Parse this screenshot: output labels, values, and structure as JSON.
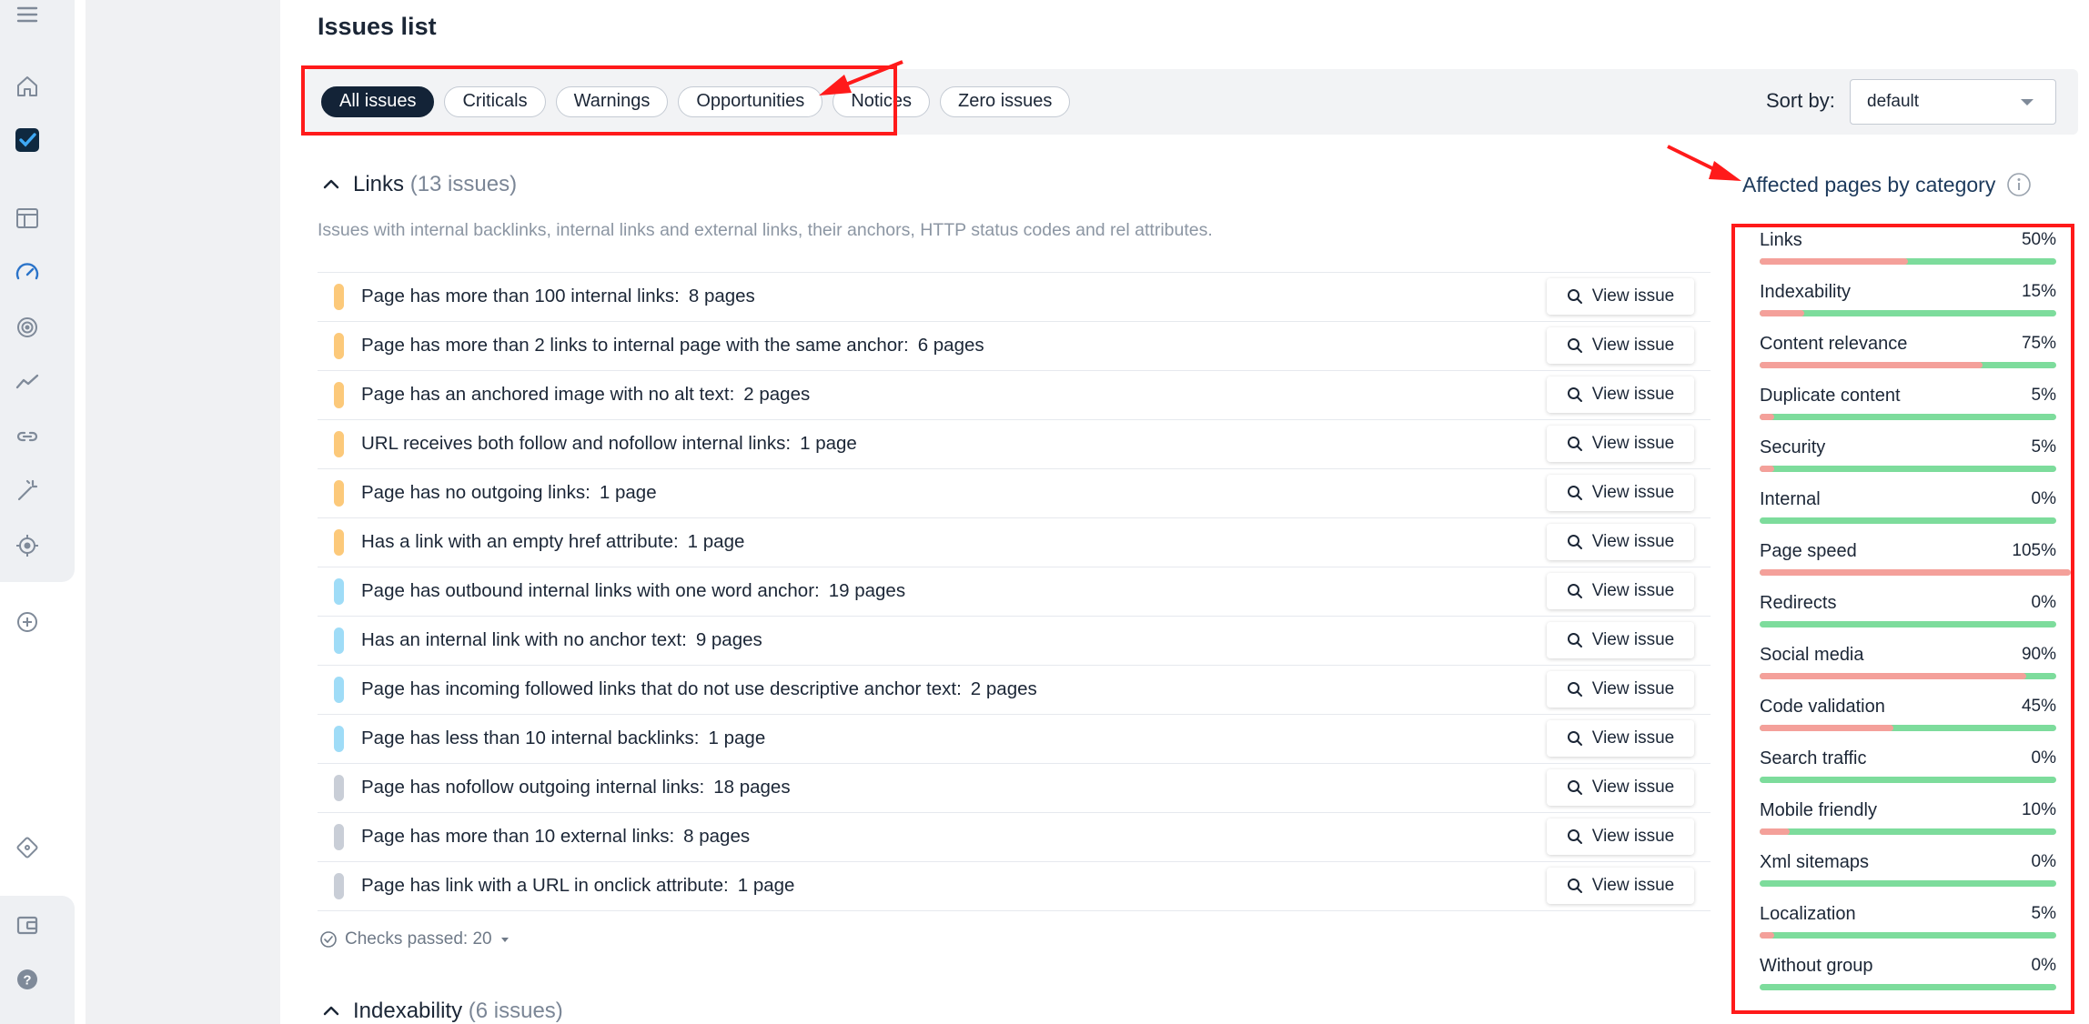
{
  "page": {
    "title": "Issues list"
  },
  "filters": {
    "chips": [
      {
        "label": "All issues",
        "active": true
      },
      {
        "label": "Criticals",
        "active": false
      },
      {
        "label": "Warnings",
        "active": false
      },
      {
        "label": "Opportunities",
        "active": false
      },
      {
        "label": "Notices",
        "active": false
      },
      {
        "label": "Zero issues",
        "active": false
      }
    ],
    "sort_label": "Sort by:",
    "sort_value": "default"
  },
  "section": {
    "title": "Links",
    "count": "(13 issues)",
    "description": "Issues with internal backlinks, internal links and external links, their anchors, HTTP status codes and rel attributes.",
    "view_label": "View issue",
    "issues": [
      {
        "text": "Page has more than 100 internal links:",
        "count": "8 pages",
        "color": "#fcc97a"
      },
      {
        "text": "Page has more than 2 links to internal page with the same anchor:",
        "count": "6 pages",
        "color": "#fcc97a"
      },
      {
        "text": "Page has an anchored image with no alt text:",
        "count": "2 pages",
        "color": "#fcc97a"
      },
      {
        "text": "URL receives both follow and nofollow internal links:",
        "count": "1 page",
        "color": "#fcc97a"
      },
      {
        "text": "Page has no outgoing links:",
        "count": "1 page",
        "color": "#fcc97a"
      },
      {
        "text": "Has a link with an empty href attribute:",
        "count": "1 page",
        "color": "#fcc97a"
      },
      {
        "text": "Page has outbound internal links with one word anchor:",
        "count": "19 pages",
        "color": "#9fdcf7"
      },
      {
        "text": "Has an internal link with no anchor text:",
        "count": "9 pages",
        "color": "#9fdcf7"
      },
      {
        "text": "Page has incoming followed links that do not use descriptive anchor text:",
        "count": "2 pages",
        "color": "#9fdcf7"
      },
      {
        "text": "Page has less than 10 internal backlinks:",
        "count": "1 page",
        "color": "#9fdcf7"
      },
      {
        "text": "Page has nofollow outgoing internal links:",
        "count": "18 pages",
        "color": "#c9ced7"
      },
      {
        "text": "Page has more than 10 external links:",
        "count": "8 pages",
        "color": "#c9ced7"
      },
      {
        "text": "Page has link with a URL in onclick attribute:",
        "count": "1 page",
        "color": "#c9ced7"
      }
    ],
    "checks_passed": "Checks passed: 20"
  },
  "section2": {
    "title": "Indexability",
    "count": "(6 issues)"
  },
  "affected": {
    "title": "Affected pages by category",
    "categories": [
      {
        "name": "Links",
        "label": "50%",
        "value": 50
      },
      {
        "name": "Indexability",
        "label": "15%",
        "value": 15
      },
      {
        "name": "Content relevance",
        "label": "75%",
        "value": 75
      },
      {
        "name": "Duplicate content",
        "label": "5%",
        "value": 5
      },
      {
        "name": "Security",
        "label": "5%",
        "value": 5
      },
      {
        "name": "Internal",
        "label": "0%",
        "value": 0
      },
      {
        "name": "Page speed",
        "label": "105%",
        "value": 105
      },
      {
        "name": "Redirects",
        "label": "0%",
        "value": 0
      },
      {
        "name": "Social media",
        "label": "90%",
        "value": 90
      },
      {
        "name": "Code validation",
        "label": "45%",
        "value": 45
      },
      {
        "name": "Search traffic",
        "label": "0%",
        "value": 0
      },
      {
        "name": "Mobile friendly",
        "label": "10%",
        "value": 10
      },
      {
        "name": "Xml sitemaps",
        "label": "0%",
        "value": 0
      },
      {
        "name": "Localization",
        "label": "5%",
        "value": 5
      },
      {
        "name": "Without group",
        "label": "0%",
        "value": 0
      }
    ]
  },
  "colors": {
    "accent": "#132337",
    "annotation": "#ff1a1a",
    "bar_good": "#7ddc9c",
    "bar_bad": "#f4a09a"
  }
}
